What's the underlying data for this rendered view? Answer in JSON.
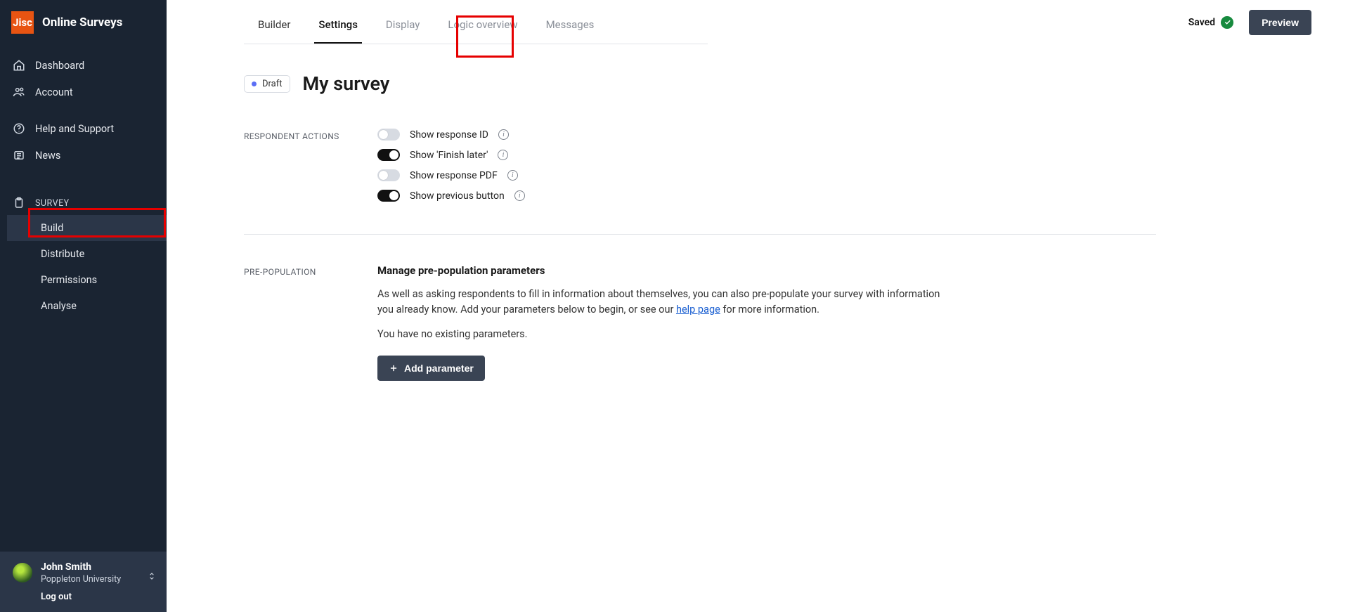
{
  "brand": {
    "logo_text": "Jisc",
    "title": "Online Surveys"
  },
  "sidebar": {
    "items": [
      {
        "label": "Dashboard"
      },
      {
        "label": "Account"
      },
      {
        "label": "Help and Support"
      },
      {
        "label": "News"
      }
    ],
    "survey_heading": "SURVEY",
    "survey_items": [
      {
        "label": "Build",
        "active": true
      },
      {
        "label": "Distribute"
      },
      {
        "label": "Permissions"
      },
      {
        "label": "Analyse"
      }
    ],
    "user": {
      "name": "John Smith",
      "org": "Poppleton University",
      "logout": "Log out"
    }
  },
  "tabs": [
    {
      "label": "Builder"
    },
    {
      "label": "Settings",
      "active": true
    },
    {
      "label": "Display"
    },
    {
      "label": "Logic overview"
    },
    {
      "label": "Messages"
    }
  ],
  "topbar": {
    "saved_label": "Saved",
    "preview_label": "Preview"
  },
  "header": {
    "status": "Draft",
    "title": "My survey"
  },
  "sections": {
    "respondent_actions_label": "RESPONDENT ACTIONS",
    "toggles": [
      {
        "label": "Show response ID",
        "on": false
      },
      {
        "label": "Show 'Finish later'",
        "on": true
      },
      {
        "label": "Show response PDF",
        "on": false
      },
      {
        "label": "Show previous button",
        "on": true
      }
    ],
    "prepop_label": "PRE-POPULATION",
    "prepop_title": "Manage pre-population parameters",
    "prepop_text_1": "As well as asking respondents to fill in information about themselves, you can also pre-populate your survey with information you already know. Add your parameters below to begin, or see our ",
    "prepop_link": "help page",
    "prepop_text_2": " for more information.",
    "no_params": "You have no existing parameters.",
    "add_param_label": "Add parameter"
  }
}
